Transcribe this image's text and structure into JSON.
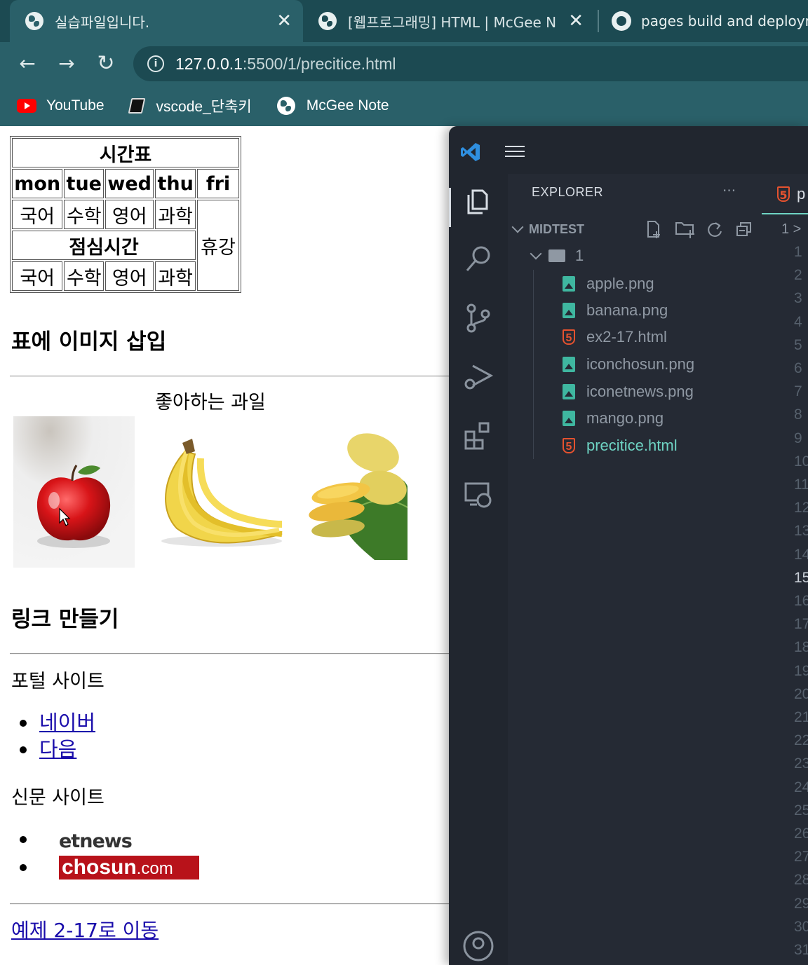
{
  "browser": {
    "tabs": [
      {
        "title": "실습파일입니다.",
        "close": "✕"
      },
      {
        "title": "[웹프로그래밍] HTML | McGee N",
        "close": "✕"
      },
      {
        "title": "pages build and deploym"
      }
    ],
    "nav": {
      "back": "←",
      "forward": "→",
      "reload": "↻"
    },
    "url_host": "127.0.0.1",
    "url_path": ":5500/1/precitice.html",
    "bookmarks": [
      {
        "label": "YouTube",
        "icon": "youtube-icon"
      },
      {
        "label": "vscode_단축키",
        "icon": "book-icon"
      },
      {
        "label": "McGee Note",
        "icon": "globe-icon"
      }
    ]
  },
  "page": {
    "timetable": {
      "title": "시간표",
      "days": [
        "mon",
        "tue",
        "wed",
        "thu",
        "fri"
      ],
      "row1": [
        "국어",
        "수학",
        "영어",
        "과학"
      ],
      "lunch": "점심시간",
      "row2": [
        "국어",
        "수학",
        "영어",
        "과학"
      ],
      "friday": "휴강"
    },
    "image_section": {
      "heading": "표에 이미지 삽입",
      "caption": "좋아하는 과일",
      "fruits": [
        "apple",
        "banana",
        "mango"
      ]
    },
    "link_section": {
      "heading": "링크 만들기",
      "portal_label": "포털 사이트",
      "portal_links": [
        "네이버",
        "다음"
      ],
      "news_label": "신문 사이트",
      "news_logos": {
        "etnews": "etnews",
        "chosun": "chosun",
        "chosun_suffix": ".com"
      },
      "example_link": "예제 2-17로 이동"
    }
  },
  "vscode": {
    "explorer_title": "EXPLORER",
    "more": "···",
    "workspace": "MIDTEST",
    "folder": "1",
    "files": [
      {
        "name": "apple.png",
        "type": "image"
      },
      {
        "name": "banana.png",
        "type": "image"
      },
      {
        "name": "ex2-17.html",
        "type": "html"
      },
      {
        "name": "iconchosun.png",
        "type": "image"
      },
      {
        "name": "iconetnews.png",
        "type": "image"
      },
      {
        "name": "mango.png",
        "type": "image"
      },
      {
        "name": "precitice.html",
        "type": "html",
        "current": true
      }
    ],
    "editor_tab_partial": "p",
    "breadcrumb_partial": "1 >",
    "line_numbers": [
      "1",
      "2",
      "3",
      "4",
      "5",
      "6",
      "7",
      "8",
      "9",
      "10",
      "11",
      "12",
      "13",
      "14",
      "15",
      "16",
      "17",
      "18",
      "19",
      "20",
      "21",
      "22",
      "23",
      "24",
      "25",
      "26",
      "27",
      "28",
      "29",
      "30",
      "31"
    ],
    "current_line": "15",
    "colors": {
      "bg": "#252a34",
      "activity": "#21262f",
      "accent": "#6ed3c3",
      "html_icon": "#e5522f",
      "image_icon": "#3fb7a0"
    }
  }
}
